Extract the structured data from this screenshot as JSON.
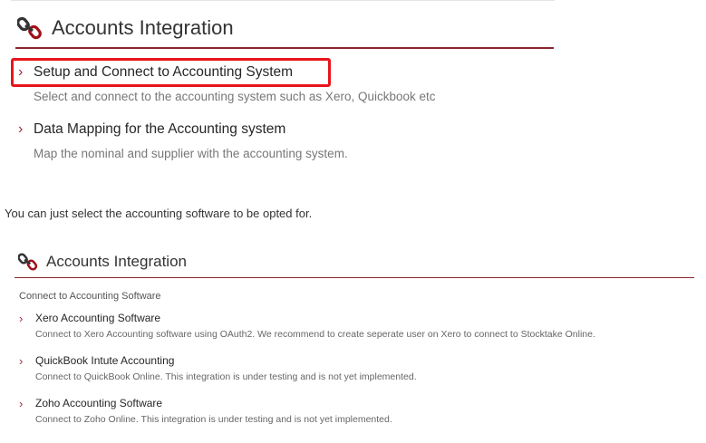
{
  "panel1": {
    "title": "Accounts Integration",
    "icon": "link-icon",
    "accent_color": "#8b2530",
    "highlight_color": "#e8141c",
    "items": [
      {
        "title": "Setup and Connect to Accounting System",
        "description": "Select and connect to the accounting system such as Xero, Quickbook etc",
        "highlighted": true
      },
      {
        "title": "Data Mapping for the Accounting system",
        "description": "Map the nominal and supplier with the accounting system.",
        "highlighted": false
      }
    ]
  },
  "instruction_text": "You can just select the accounting software to be opted for.",
  "panel2": {
    "title": "Accounts Integration",
    "icon": "link-icon",
    "subtitle": "Connect to Accounting Software",
    "items": [
      {
        "title": "Xero Accounting Software",
        "description": "Connect to Xero Accounting software using OAuth2. We recommend to create seperate user on Xero to connect to Stocktake Online."
      },
      {
        "title": "QuickBook Intute Accounting",
        "description": "Connect to QuickBook Online. This integration is under testing and is not yet implemented."
      },
      {
        "title": "Zoho Accounting Software",
        "description": "Connect to Zoho Online. This integration is under testing and is not yet implemented."
      }
    ]
  }
}
